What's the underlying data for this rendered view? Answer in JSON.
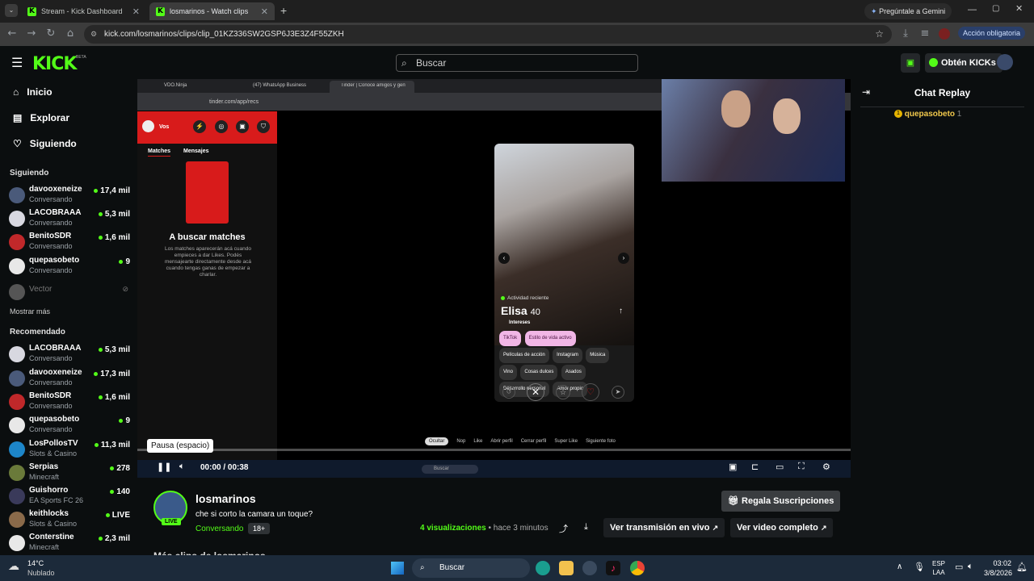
{
  "browser": {
    "tabs": [
      {
        "title": "Stream - Kick Dashboard"
      },
      {
        "title": "losmarinos - Watch clips o"
      }
    ],
    "url": "kick.com/losmarinos/clips/clip_01KZ336SW2GSP6J3E3Z4F55ZKH",
    "gemini": "Pregúntale a Gemini",
    "accion": "Acción obligatoria"
  },
  "header": {
    "logo": "KICK",
    "beta": "BETA",
    "search_placeholder": "Buscar",
    "get_kicks": "Obtén KICKs"
  },
  "sidebar": {
    "nav": [
      {
        "label": "Inicio",
        "icon": "home-icon"
      },
      {
        "label": "Explorar",
        "icon": "compass-icon"
      },
      {
        "label": "Siguiendo",
        "icon": "heart-icon"
      }
    ],
    "following_title": "Siguiendo",
    "following": [
      {
        "name": "davooxeneize",
        "category": "Conversando",
        "viewers": "17,4 mil"
      },
      {
        "name": "LACOBRAAA",
        "category": "Conversando",
        "viewers": "5,3 mil"
      },
      {
        "name": "BenitoSDR",
        "category": "Conversando",
        "viewers": "1,6 mil"
      },
      {
        "name": "quepasobeto",
        "category": "Conversando",
        "viewers": "9"
      }
    ],
    "offline": {
      "name": "Vector"
    },
    "show_more": "Mostrar más",
    "recommended_title": "Recomendado",
    "recommended": [
      {
        "name": "LACOBRAAA",
        "category": "Conversando",
        "viewers": "5,3 mil"
      },
      {
        "name": "davooxeneize",
        "category": "Conversando",
        "viewers": "17,3 mil"
      },
      {
        "name": "BenitoSDR",
        "category": "Conversando",
        "viewers": "1,6 mil"
      },
      {
        "name": "quepasobeto",
        "category": "Conversando",
        "viewers": "9"
      },
      {
        "name": "LosPollosTV",
        "category": "Slots & Casino",
        "viewers": "11,3 mil"
      },
      {
        "name": "Serpias",
        "category": "Minecraft",
        "viewers": "278"
      },
      {
        "name": "Guishorro",
        "category": "EA Sports FC 26",
        "viewers": "140"
      },
      {
        "name": "keithlocks",
        "category": "Slots & Casino",
        "viewers": "LIVE"
      },
      {
        "name": "Conterstine",
        "category": "Minecraft",
        "viewers": "2,3 mil"
      }
    ]
  },
  "video": {
    "inner_tabs": [
      "VDO.Ninja",
      "(47) WhatsApp Business",
      "Tinder | Conocé amigos y gent"
    ],
    "inner_url": "tinder.com/app/recs",
    "tinder": {
      "user": "Vos",
      "tab_matches": "Matches",
      "tab_messages": "Mensajes",
      "empty_title": "A buscar matches",
      "empty_text": "Los matches aparecerán acá cuando empieces a dar Likes. Podés mensajearte directamente desde acá cuando tengas ganas de empezar a charlar.",
      "profile": {
        "activity": "Actividad reciente",
        "name": "Elisa",
        "age": "40",
        "interests_label": "Intereses",
        "tags_pink": [
          "TikTok",
          "Estilo de vida activo"
        ],
        "tags": [
          "Películas de acción",
          "Instagram",
          "Música",
          "Vino",
          "Cosas dulces",
          "Asados",
          "Desarrollo personal",
          "Amor propio"
        ]
      },
      "hints": [
        "Ocultar",
        "Nop",
        "Like",
        "Abrir perfil",
        "Cerrar perfil",
        "Super Like",
        "Siguiente foto"
      ]
    },
    "tooltip": "Pausa (espacio)",
    "time": "00:00 / 00:38",
    "progress": 0.0,
    "inner_search": "Buscar"
  },
  "chat": {
    "title": "Chat Replay",
    "user": "quepasobeto",
    "count": "1"
  },
  "clip": {
    "channel": "losmarinos",
    "live": "LIVE",
    "title": "che si corto la camara un toque?",
    "category": "Conversando",
    "rating": "18+",
    "views_count": "4",
    "views_label": "visualizaciones",
    "time_ago": "• hace 3 minutos",
    "gift": "Regala Suscripciones",
    "watch_live": "Ver transmisión en vivo",
    "watch_full": "Ver video completo",
    "more": "Más clips de losmarinos"
  },
  "taskbar": {
    "weather_temp": "14°C",
    "weather_text": "Nublado",
    "search": "Buscar",
    "lang1": "ESP",
    "lang2": "LAA",
    "time": "03:02",
    "date": "3/8/2026"
  },
  "colors": {
    "accent": "#53fc18",
    "tinder_red": "#d81b1b"
  }
}
